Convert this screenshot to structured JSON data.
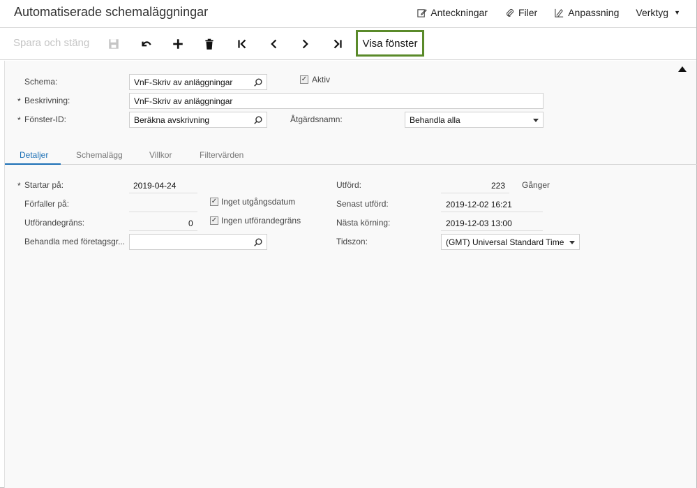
{
  "header": {
    "title": "Automatiserade schemaläggningar",
    "menu": {
      "notes": "Anteckningar",
      "files": "Filer",
      "customization": "Anpassning",
      "tools": "Verktyg"
    }
  },
  "toolbar": {
    "save_close": "Spara och stäng",
    "visa_fonster": "Visa fönster"
  },
  "form": {
    "schema_label": "Schema:",
    "schema_value": "VnF-Skriv av anläggningar",
    "aktiv_label": "Aktiv",
    "beskrivning_label": "Beskrivning:",
    "beskrivning_value": "VnF-Skriv av anläggningar",
    "fonster_label": "Fönster-ID:",
    "fonster_value": "Beräkna avskrivning",
    "atgard_label": "Åtgärdsnamn:",
    "atgard_value": "Behandla alla"
  },
  "tabs": [
    "Detaljer",
    "Schemalägg",
    "Villkor",
    "Filtervärden"
  ],
  "details": {
    "startar_label": "Startar på:",
    "startar_value": "2019-04-24",
    "forfaller_label": "Förfaller på:",
    "inget_utgang": "Inget utgångsdatum",
    "utforandegrans_label": "Utförandegräns:",
    "utforandegrans_value": "0",
    "ingen_utforandegrans": "Ingen utförandegräns",
    "behandla_label": "Behandla med företagsgr...",
    "utford_label": "Utförd:",
    "utford_value": "223",
    "ganger": "Gånger",
    "senast_label": "Senast utförd:",
    "senast_value": "2019-12-02 16:21",
    "nasta_label": "Nästa körning:",
    "nasta_value": "2019-12-03 13:00",
    "tidszon_label": "Tidszon:",
    "tidszon_value": "(GMT) Universal Standard Time"
  }
}
